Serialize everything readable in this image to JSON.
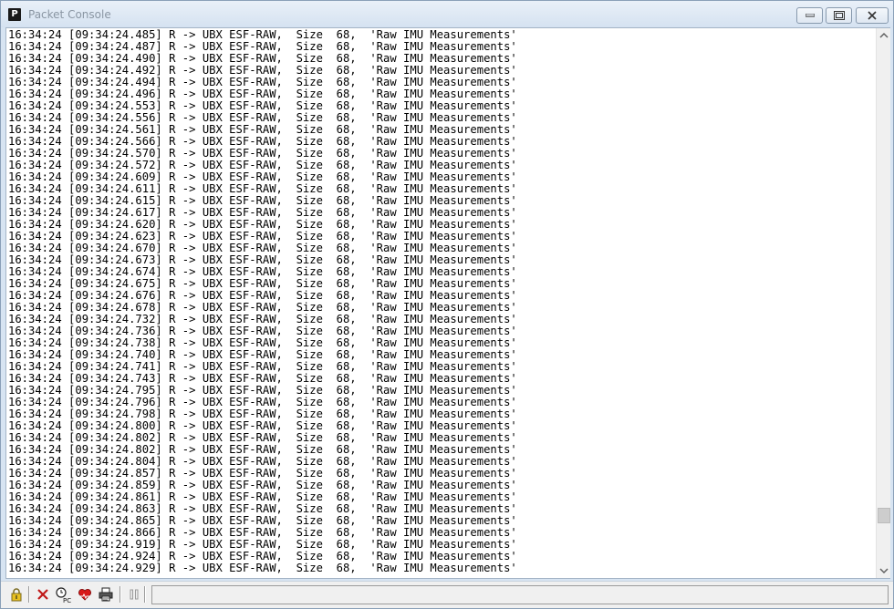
{
  "window": {
    "title": "Packet Console",
    "icon_letter": "P",
    "controls": [
      "minimize-icon",
      "maximize-icon",
      "close-icon"
    ]
  },
  "log": {
    "time": "16:34:24",
    "direction": "R ->",
    "message": "UBX ESF-RAW,",
    "size_label": "Size",
    "size": "68,",
    "description": "'Raw IMU Measurements'",
    "timestamps": [
      "09:34:24.485",
      "09:34:24.487",
      "09:34:24.490",
      "09:34:24.492",
      "09:34:24.494",
      "09:34:24.496",
      "09:34:24.553",
      "09:34:24.556",
      "09:34:24.561",
      "09:34:24.566",
      "09:34:24.570",
      "09:34:24.572",
      "09:34:24.609",
      "09:34:24.611",
      "09:34:24.615",
      "09:34:24.617",
      "09:34:24.620",
      "09:34:24.623",
      "09:34:24.670",
      "09:34:24.673",
      "09:34:24.674",
      "09:34:24.675",
      "09:34:24.676",
      "09:34:24.678",
      "09:34:24.732",
      "09:34:24.736",
      "09:34:24.738",
      "09:34:24.740",
      "09:34:24.741",
      "09:34:24.743",
      "09:34:24.795",
      "09:34:24.796",
      "09:34:24.798",
      "09:34:24.800",
      "09:34:24.802",
      "09:34:24.802",
      "09:34:24.804",
      "09:34:24.857",
      "09:34:24.859",
      "09:34:24.861",
      "09:34:24.863",
      "09:34:24.865",
      "09:34:24.866",
      "09:34:24.919",
      "09:34:24.924",
      "09:34:24.929"
    ]
  },
  "scrollbar": {
    "position": 0.92
  },
  "toolbar": {
    "buttons": [
      "lock-icon",
      "clear-icon",
      "pc-time-icon",
      "heart-icon",
      "print-icon",
      "pause-icon"
    ]
  },
  "colors": {
    "titlebar": "#d5e2f1",
    "title_text": "#8a96a3",
    "close_x": "#b02020"
  }
}
